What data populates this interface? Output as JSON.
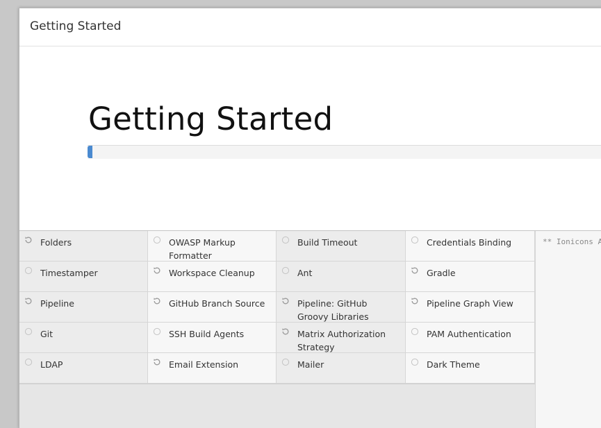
{
  "dialog": {
    "title": "Getting Started"
  },
  "hero": {
    "title": "Getting Started",
    "progress": 0.01
  },
  "plugins": [
    {
      "label": "Folders",
      "status": "installing"
    },
    {
      "label": "OWASP Markup Formatter",
      "status": "pending"
    },
    {
      "label": "Build Timeout",
      "status": "pending"
    },
    {
      "label": "Credentials Binding",
      "status": "pending"
    },
    {
      "label": "Timestamper",
      "status": "pending"
    },
    {
      "label": "Workspace Cleanup",
      "status": "installing"
    },
    {
      "label": "Ant",
      "status": "pending"
    },
    {
      "label": "Gradle",
      "status": "installing"
    },
    {
      "label": "Pipeline",
      "status": "installing"
    },
    {
      "label": "GitHub Branch Source",
      "status": "installing"
    },
    {
      "label": "Pipeline: GitHub Groovy Libraries",
      "status": "installing"
    },
    {
      "label": "Pipeline Graph View",
      "status": "installing"
    },
    {
      "label": "Git",
      "status": "pending"
    },
    {
      "label": "SSH Build Agents",
      "status": "pending"
    },
    {
      "label": "Matrix Authorization Strategy",
      "status": "installing"
    },
    {
      "label": "PAM Authentication",
      "status": "pending"
    },
    {
      "label": "LDAP",
      "status": "pending"
    },
    {
      "label": "Email Extension",
      "status": "installing"
    },
    {
      "label": "Mailer",
      "status": "pending"
    },
    {
      "label": "Dark Theme",
      "status": "pending"
    }
  ],
  "log": {
    "text": "** Ionicons AP"
  },
  "colors": {
    "progress": "#4a8ad0",
    "icon": "#9a9a9a"
  }
}
